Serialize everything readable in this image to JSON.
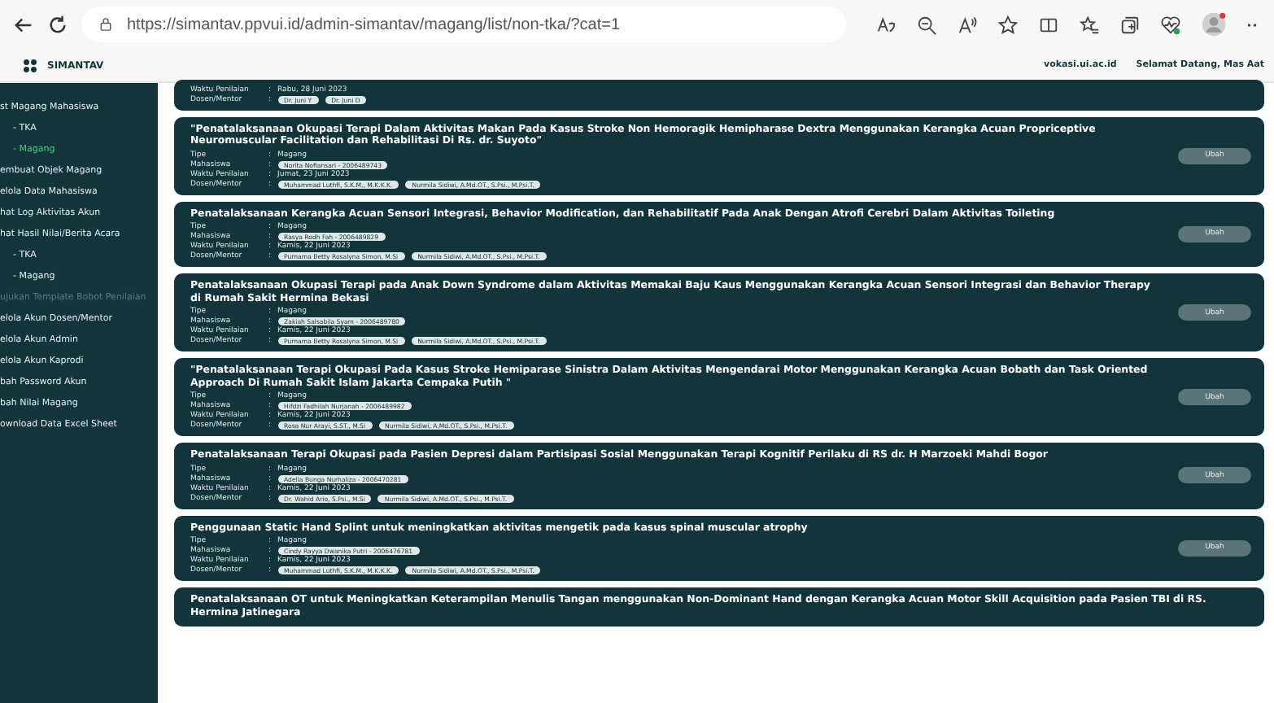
{
  "browser": {
    "url": "https://simantav.ppvui.id/admin-simantav/magang/list/non-tka/?cat=1"
  },
  "header": {
    "brand": "SIMANTAV",
    "site": "vokasi.ui.ac.id",
    "greeting": "Selamat Datang, Mas Aat"
  },
  "sidebar": {
    "items": [
      {
        "label": "st Magang Mahasiswa",
        "selected": false,
        "disabled": false,
        "children": [
          {
            "label": "- TKA",
            "selected": false,
            "disabled": false
          },
          {
            "label": "- Magang",
            "selected": true,
            "disabled": false
          }
        ]
      },
      {
        "label": "embuat Objek Magang",
        "selected": false,
        "disabled": false
      },
      {
        "label": "elola Data Mahasiswa",
        "selected": false,
        "disabled": false
      },
      {
        "label": "hat Log Aktivitas Akun",
        "selected": false,
        "disabled": false
      },
      {
        "label": "hat Hasil Nilai/Berita Acara",
        "selected": false,
        "disabled": false,
        "children": [
          {
            "label": "- TKA",
            "selected": false,
            "disabled": false
          },
          {
            "label": "- Magang",
            "selected": false,
            "disabled": false
          }
        ]
      },
      {
        "label": "ujukan Template Bobot Penilaian",
        "selected": false,
        "disabled": true
      },
      {
        "label": "elola Akun Dosen/Mentor",
        "selected": false,
        "disabled": false
      },
      {
        "label": "elola Akun Admin",
        "selected": false,
        "disabled": false
      },
      {
        "label": "elola Akun Kaprodi",
        "selected": false,
        "disabled": false
      },
      {
        "label": "bah Password Akun",
        "selected": false,
        "disabled": false
      },
      {
        "label": "bah Nilai Magang",
        "selected": false,
        "disabled": false
      },
      {
        "label": "ownload Data Excel Sheet",
        "selected": false,
        "disabled": false
      }
    ]
  },
  "cards": [
    {
      "fields": [
        {
          "label": "Waktu Penilaian",
          "sep": ":",
          "value": "Rabu, 28 Juni 2023"
        },
        {
          "label": "Dosen/Mentor",
          "sep": ":",
          "pills": [
            "Dr. Juni Y",
            "Dr. Juni D"
          ]
        }
      ]
    },
    {
      "title": "\"Penatalaksanaan Okupasi Terapi Dalam Aktivitas Makan Pada Kasus Stroke Non Hemoragik Hemipharase Dextra Menggunakan Kerangka Acuan Propriceptive Neuromuscular Facilitation dan Rehabilitasi Di Rs. dr. Suyoto\"",
      "button": "Ubah",
      "fields": [
        {
          "label": "Tipe",
          "sep": ":",
          "value": "Magang"
        },
        {
          "label": "Mahasiswa",
          "sep": ":",
          "pills": [
            "Norita Nofiansari - 2006489743"
          ]
        },
        {
          "label": "Waktu Penilaian",
          "sep": ":",
          "value": "Jumat, 23 Juni 2023"
        },
        {
          "label": "Dosen/Mentor",
          "sep": ":",
          "pills": [
            "Muhammad Luthfi, S.K.M., M.K.K.K.",
            "Nurmila Sidiwi, A.Md.OT., S.Psi., M.Psi.T."
          ]
        }
      ]
    },
    {
      "title": "Penatalaksanaan Kerangka Acuan Sensori Integrasi, Behavior Modification, dan Rehabilitatif Pada Anak Dengan Atrofi Cerebri Dalam Aktivitas Toileting",
      "button": "Ubah",
      "fields": [
        {
          "label": "Tipe",
          "sep": ":",
          "value": "Magang"
        },
        {
          "label": "Mahasiswa",
          "sep": ":",
          "pills": [
            "Rasya Rodh Fah - 2006489829"
          ]
        },
        {
          "label": "Waktu Penilaian",
          "sep": ":",
          "value": "Kamis, 22 Juni 2023"
        },
        {
          "label": "Dosen/Mentor",
          "sep": ":",
          "pills": [
            "Purnama Betty Rosalyna Simon, M.Si",
            "Nurmila Sidiwi, A.Md.OT., S.Psi., M.Psi.T."
          ]
        }
      ]
    },
    {
      "title": "Penatalaksanaan Okupasi Terapi pada Anak Down Syndrome dalam Aktivitas Memakai Baju Kaus Menggunakan Kerangka Acuan Sensori Integrasi dan Behavior Therapy di Rumah Sakit Hermina Bekasi",
      "button": "Ubah",
      "fields": [
        {
          "label": "Tipe",
          "sep": ":",
          "value": "Magang"
        },
        {
          "label": "Mahasiswa",
          "sep": ":",
          "pills": [
            "Zakiah Salsabila Syam - 2006489780"
          ]
        },
        {
          "label": "Waktu Penilaian",
          "sep": ":",
          "value": "Kamis, 22 Juni 2023"
        },
        {
          "label": "Dosen/Mentor",
          "sep": ":",
          "pills": [
            "Purnama Betty Rosalyna Simon, M.Si",
            "Nurmila Sidiwi, A.Md.OT., S.Psi., M.Psi.T."
          ]
        }
      ]
    },
    {
      "title": "\"Penatalaksanaan Terapi Okupasi Pada Kasus Stroke Hemiparase Sinistra Dalam Aktivitas Mengendarai Motor Menggunakan Kerangka Acuan Bobath dan Task Oriented Approach Di Rumah Sakit Islam Jakarta Cempaka Putih \"",
      "button": "Ubah",
      "fields": [
        {
          "label": "Tipe",
          "sep": ":",
          "value": "Magang"
        },
        {
          "label": "Mahasiswa",
          "sep": ":",
          "pills": [
            "Hifdzi Fadhilah Nurjanah - 2006489982"
          ]
        },
        {
          "label": "Waktu Penilaian",
          "sep": ":",
          "value": "Kamis, 22 Juni 2023"
        },
        {
          "label": "Dosen/Mentor",
          "sep": ":",
          "pills": [
            "Rosa Nur Arayi, S.ST., M.Si",
            "Nurmila Sidiwi, A.Md.OT., S.Psi., M.Psi.T."
          ]
        }
      ]
    },
    {
      "title": "Penatalaksanaan Terapi Okupasi pada Pasien Depresi dalam Partisipasi Sosial Menggunakan Terapi Kognitif Perilaku di RS dr. H Marzoeki Mahdi Bogor",
      "button": "Ubah",
      "fields": [
        {
          "label": "Tipe",
          "sep": ":",
          "value": "Magang"
        },
        {
          "label": "Mahasiswa",
          "sep": ":",
          "pills": [
            "Adella Bunga Nurhaliza - 2006470281"
          ]
        },
        {
          "label": "Waktu Penilaian",
          "sep": ":",
          "value": "Kamis, 22 Juni 2023"
        },
        {
          "label": "Dosen/Mentor",
          "sep": ":",
          "pills": [
            "Dr. Wahid Ario, S.Psi., M.Si",
            "Nurmila Sidiwi, A.Md.OT., S.Psi., M.Psi.T."
          ]
        }
      ]
    },
    {
      "title": "Penggunaan Static Hand Splint untuk meningkatkan aktivitas mengetik pada kasus spinal muscular atrophy",
      "button": "Ubah",
      "fields": [
        {
          "label": "Tipe",
          "sep": ":",
          "value": "Magang"
        },
        {
          "label": "Mahasiswa",
          "sep": ":",
          "pills": [
            "Cindy Rayya Dwanika Putri - 2006476781"
          ]
        },
        {
          "label": "Waktu Penilaian",
          "sep": ":",
          "value": "Kamis, 22 Juni 2023"
        },
        {
          "label": "Dosen/Mentor",
          "sep": ":",
          "pills": [
            "Muhammad Luthfi, S.K.M., M.K.K.K.",
            "Nurmila Sidiwi, A.Md.OT., S.Psi., M.Psi.T."
          ]
        }
      ]
    },
    {
      "title": "Penatalaksanaan OT untuk Meningkatkan Keterampilan Menulis Tangan menggunakan Non-Dominant Hand dengan Kerangka Acuan Motor Skill Acquisition pada Pasien TBI di RS. Hermina Jatinegara"
    }
  ]
}
